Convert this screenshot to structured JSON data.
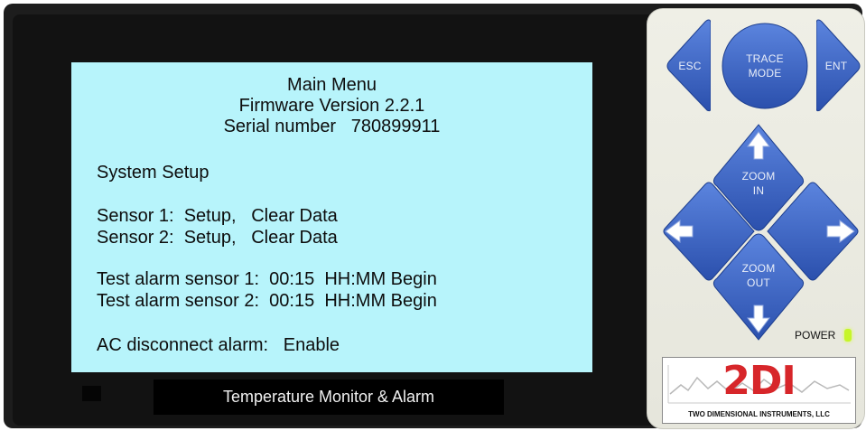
{
  "screen": {
    "header": {
      "title": "Main Menu",
      "firmware": "Firmware Version 2.2.1",
      "serial": "Serial number   780899911"
    },
    "menu": {
      "system_setup": "System Setup",
      "sensor1": "Sensor 1:  Setup,   Clear Data",
      "sensor2": "Sensor 2:  Setup,   Clear Data",
      "test_alarm1": "Test alarm sensor 1:  00:15  HH:MM Begin",
      "test_alarm2": "Test alarm sensor 2:  00:15  HH:MM Begin",
      "ac_alarm": "AC disconnect alarm:   Enable"
    }
  },
  "device": {
    "label": "Temperature Monitor & Alarm"
  },
  "keypad": {
    "esc": "ESC",
    "trace_mode_1": "TRACE",
    "trace_mode_2": "MODE",
    "ent": "ENT",
    "zoom_in_1": "ZOOM",
    "zoom_in_2": "IN",
    "zoom_out_1": "ZOOM",
    "zoom_out_2": "OUT",
    "power_label": "POWER"
  },
  "logo": {
    "mark": "2DI",
    "company": "TWO DIMENSIONAL INSTRUMENTS, LLC"
  },
  "colors": {
    "screen_bg": "#b7f4fb",
    "key_blue": "#3a64c6",
    "power_led": "#c6f52a",
    "logo_red": "#d7262a"
  },
  "icons": [
    "arrow-up-icon",
    "arrow-down-icon",
    "arrow-left-icon",
    "arrow-right-icon",
    "power-led-icon"
  ]
}
